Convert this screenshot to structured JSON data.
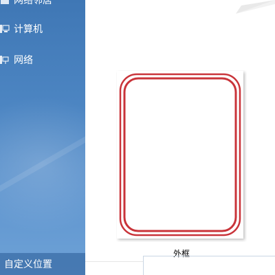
{
  "sidebar": {
    "items": [
      {
        "label": "网络邻居",
        "icon": "folder-icon"
      },
      {
        "label": "计算机",
        "icon": "computer-icon"
      },
      {
        "label": "网络",
        "icon": "network-icon"
      }
    ],
    "custom_location": "自定义位置"
  },
  "content": {
    "frame_caption": "外框",
    "frame_color": "#c9343a"
  }
}
